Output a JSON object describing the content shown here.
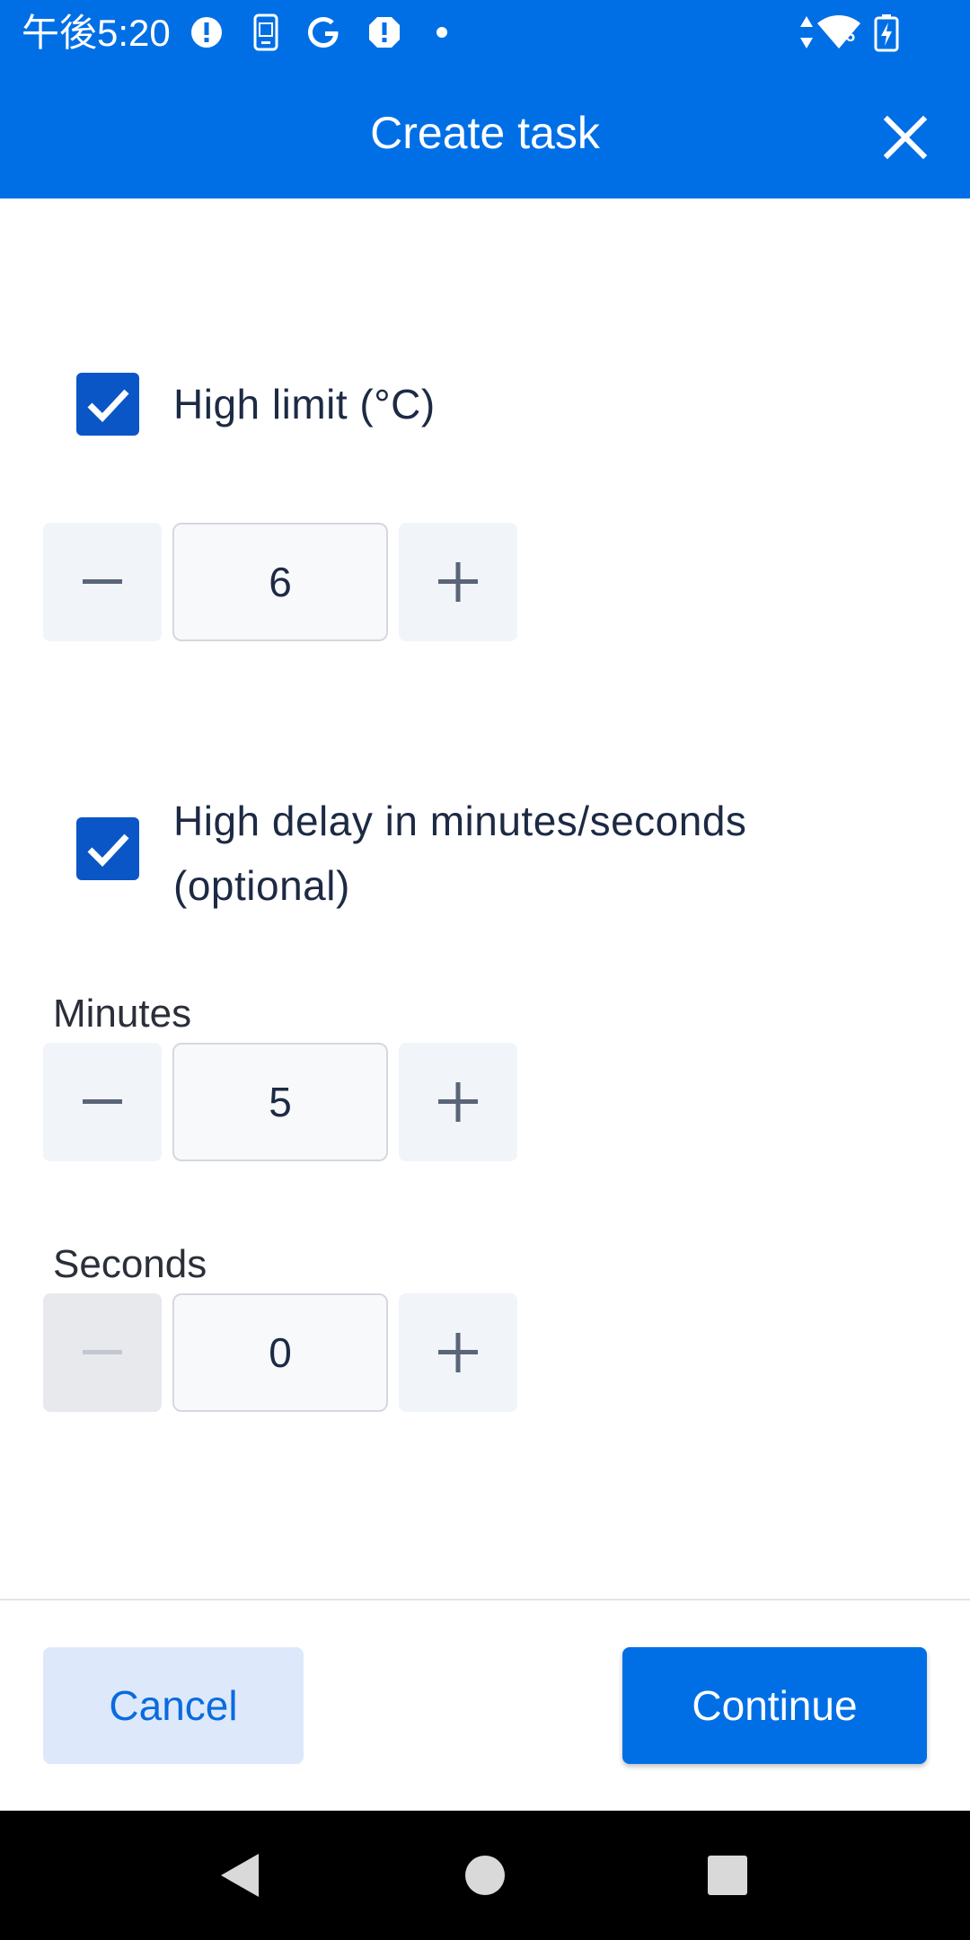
{
  "status_bar": {
    "time": "午後5:20",
    "icons": [
      "alert-icon",
      "phone-screen-icon",
      "google-icon",
      "alert-icon",
      "dot-icon",
      "data-arrows-icon",
      "wifi-icon",
      "battery-charging-icon"
    ],
    "wifi_badge": "5"
  },
  "header": {
    "title": "Create task",
    "close_icon": "close-icon"
  },
  "high_limit": {
    "checked": true,
    "label": "High limit (°C)",
    "value": "6",
    "minus_icon": "minus-icon",
    "plus_icon": "plus-icon"
  },
  "high_delay": {
    "checked": true,
    "label_line1": "High delay in minutes/seconds",
    "label_line2": "(optional)",
    "minutes": {
      "label": "Minutes",
      "value": "5"
    },
    "seconds": {
      "label": "Seconds",
      "value": "0",
      "minus_disabled": true
    }
  },
  "footer": {
    "cancel_label": "Cancel",
    "continue_label": "Continue"
  },
  "nav_bar": {
    "icons": [
      "back-icon",
      "home-icon",
      "recents-icon"
    ]
  },
  "colors": {
    "primary": "#006fe6",
    "checkbox": "#0a56c7",
    "cancel_bg": "#dde9fb"
  }
}
